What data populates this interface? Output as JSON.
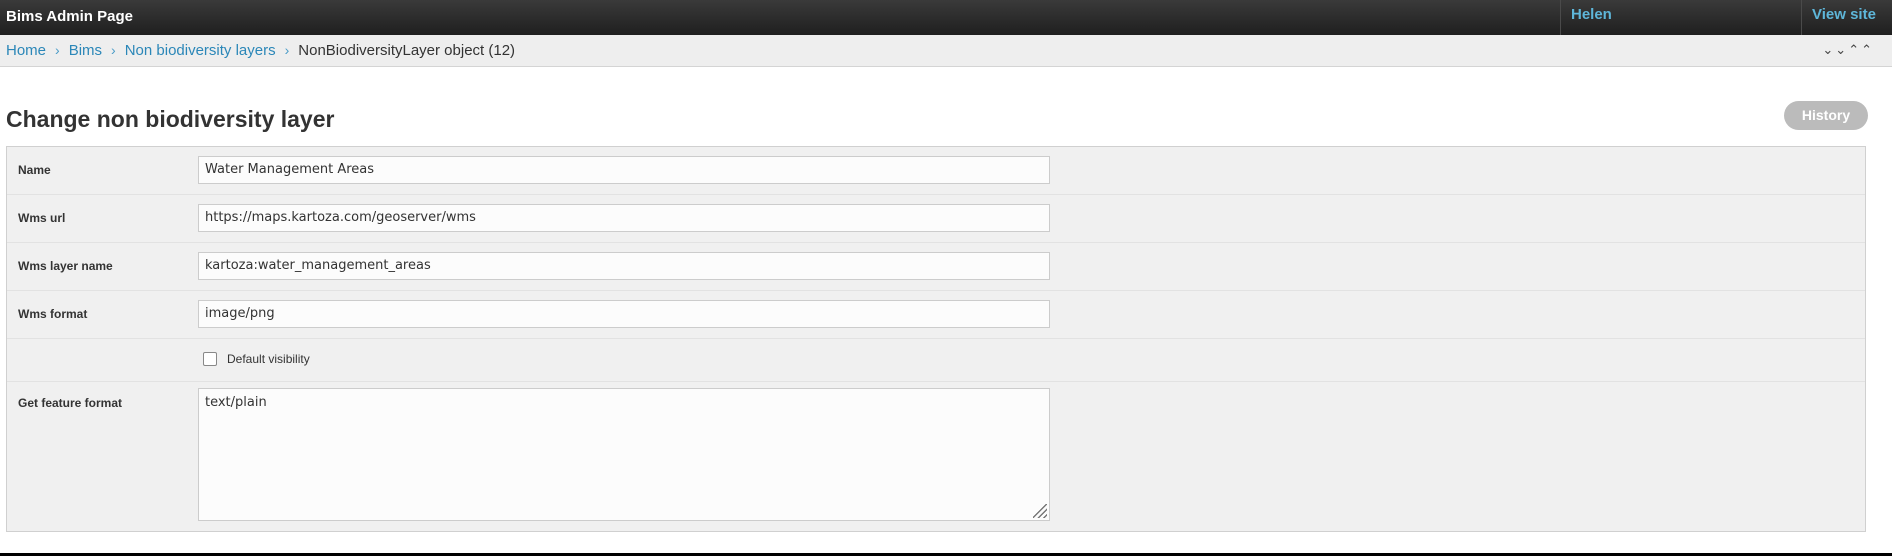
{
  "header": {
    "site_title": "Bims Admin Page",
    "user": "Helen",
    "view_site": "View site"
  },
  "breadcrumbs": {
    "items": [
      "Home",
      "Bims",
      "Non biodiversity layers"
    ],
    "current": "NonBiodiversityLayer object (12)",
    "separator": "›"
  },
  "page": {
    "title": "Change non biodiversity layer",
    "history_button": "History"
  },
  "form": {
    "name": {
      "label": "Name",
      "value": "Water Management Areas"
    },
    "wms_url": {
      "label": "Wms url",
      "value": "https://maps.kartoza.com/geoserver/wms"
    },
    "wms_layer_name": {
      "label": "Wms layer name",
      "value": "kartoza:water_management_areas"
    },
    "wms_format": {
      "label": "Wms format",
      "value": "image/png"
    },
    "default_visibility": {
      "label": "Default visibility",
      "checked": false
    },
    "get_feature_format": {
      "label": "Get feature format",
      "value": "text/plain"
    }
  },
  "colors": {
    "link": "#2b87b8",
    "header_link": "#5eb6d9",
    "header_bg": "#2a2a2a"
  }
}
